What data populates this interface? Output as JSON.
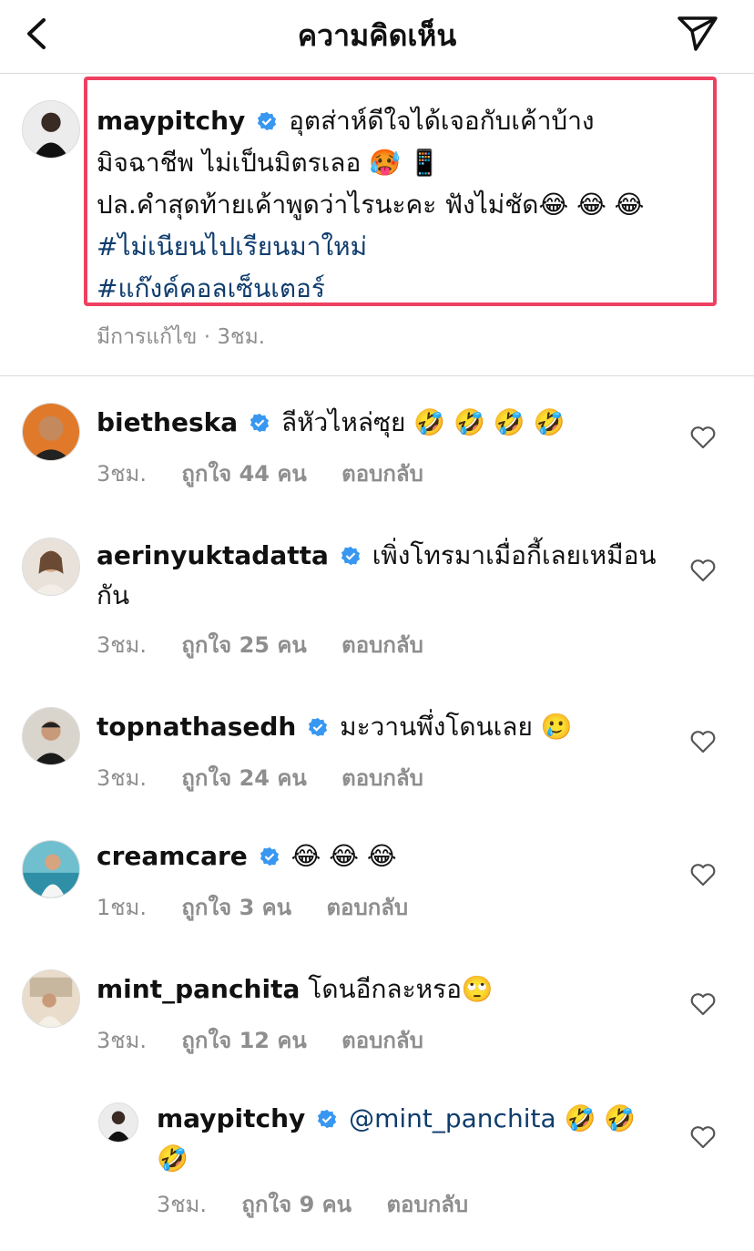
{
  "header": {
    "title": "ความคิดเห็น"
  },
  "caption": {
    "username": "maypitchy",
    "text_line1": "อุตส่าห์ดีใจได้เจอกับเค้าบ้าง",
    "text_line2": "มิจฉาชีพ ไม่เป็นมิตรเลอ 🥵 📱",
    "text_line3": "ปล.คำสุดท้ายเค้าพูดว่าไรนะคะ ฟังไม่ชัด😂 😂 😂",
    "hashtag1": "#ไม่เนียนไปเรียนมาใหม่",
    "hashtag2": "#แก๊งค์คอลเซ็นเตอร์",
    "meta": "มีการแก้ไข · 3ชม."
  },
  "comments": [
    {
      "username": "bietheska",
      "text": "ลีหัวไหล่ซุย 🤣 🤣 🤣 🤣",
      "time": "3ชม.",
      "likes": "ถูกใจ 44 คน",
      "reply": "ตอบกลับ"
    },
    {
      "username": "aerinyuktadatta",
      "text": "เพิ่งโทรมาเมื่อกี้เลยเหมือนกัน",
      "time": "3ชม.",
      "likes": "ถูกใจ 25 คน",
      "reply": "ตอบกลับ"
    },
    {
      "username": "topnathasedh",
      "text": "มะวานพึ่งโดนเลย 🥲",
      "time": "3ชม.",
      "likes": "ถูกใจ 24 คน",
      "reply": "ตอบกลับ"
    },
    {
      "username": "creamcare",
      "text": "😂 😂 😂",
      "time": "1ชม.",
      "likes": "ถูกใจ 3 คน",
      "reply": "ตอบกลับ"
    },
    {
      "username": "mint_panchita",
      "text": "โดนอีกละหรอ🙄",
      "time": "3ชม.",
      "likes": "ถูกใจ 12 คน",
      "reply": "ตอบกลับ"
    },
    {
      "username": "maypitchy",
      "mention": "@mint_panchita",
      "text": "🤣 🤣 🤣",
      "time": "3ชม.",
      "likes": "ถูกใจ 9 คน",
      "reply": "ตอบกลับ"
    }
  ],
  "colors": {
    "accent_box": "#ee4060",
    "verified": "#3897f0",
    "link": "#0f3d6e",
    "meta": "#8e8e8e"
  }
}
